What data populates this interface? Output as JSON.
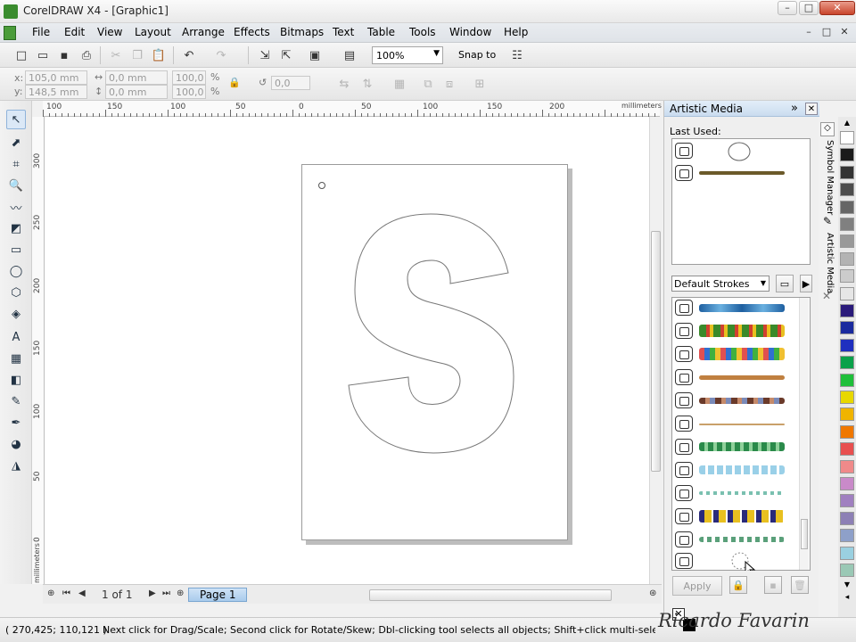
{
  "window": {
    "title": "CorelDRAW X4 - [Graphic1]",
    "min": "–",
    "max": "□",
    "close": "✕"
  },
  "menu": {
    "items": [
      "File",
      "Edit",
      "View",
      "Layout",
      "Arrange",
      "Effects",
      "Bitmaps",
      "Text",
      "Table",
      "Tools",
      "Window",
      "Help"
    ],
    "mdi": [
      "–",
      "□",
      "✕"
    ]
  },
  "standard_toolbar": {
    "zoom": "100%",
    "snap_label": "Snap to"
  },
  "property_bar": {
    "x_label": "x:",
    "y_label": "y:",
    "x": "105,0 mm",
    "y": "148,5 mm",
    "w": "0,0 mm",
    "h": "0,0 mm",
    "scale_x": "100,0",
    "scale_y": "100,0",
    "pct": "%",
    "angle": "0,0"
  },
  "rulers": {
    "h_ticks": [
      "100",
      "150",
      "100",
      "50",
      "0",
      "50",
      "100",
      "150",
      "200"
    ],
    "unit": "millimeters",
    "v_ticks": [
      "300",
      "250",
      "200",
      "150",
      "100",
      "50",
      "0"
    ],
    "v_unit": "millimeters"
  },
  "page_nav": {
    "counter": "1 of 1",
    "tab": "Page 1"
  },
  "status": {
    "coords": "( 270,425; 110,121 )",
    "message": "Next click for Drag/Scale; Second click for Rotate/Skew; Dbl-clicking tool selects all objects; Shift+click multi-selects; Alt+click digs"
  },
  "docker": {
    "title": "Artistic Media",
    "last_used_label": "Last Used:",
    "preset": "Default Strokes",
    "apply": "Apply"
  },
  "side_tabs": [
    "Symbol Manager",
    "Artistic Media"
  ],
  "watermark": "Ricardo Favarin",
  "palette": [
    "#ffffff",
    "#1a1a1a",
    "#333333",
    "#4d4d4d",
    "#666666",
    "#808080",
    "#999999",
    "#b3b3b3",
    "#cccccc",
    "#e6e6e6",
    "#2a1a7a",
    "#1a2a9e",
    "#1f2fbf",
    "#0aa14a",
    "#1fbf3a",
    "#e8d800",
    "#f0b400",
    "#f07800",
    "#e85050",
    "#f08a8a",
    "#c98ac9",
    "#a080c0",
    "#8d80b5",
    "#8ea0c9",
    "#9ad0e0",
    "#9ac8b5"
  ],
  "icons": {
    "tools": [
      "pick-tool-icon",
      "shape-tool-icon",
      "crop-tool-icon",
      "zoom-tool-icon",
      "freehand-tool-icon",
      "smart-fill-icon",
      "rectangle-tool-icon",
      "ellipse-tool-icon",
      "polygon-tool-icon",
      "basic-shapes-icon",
      "text-tool-icon",
      "table-tool-icon",
      "interactive-blend-icon",
      "eyedropper-icon",
      "outline-pen-icon",
      "fill-bucket-icon",
      "interactive-fill-icon"
    ]
  }
}
